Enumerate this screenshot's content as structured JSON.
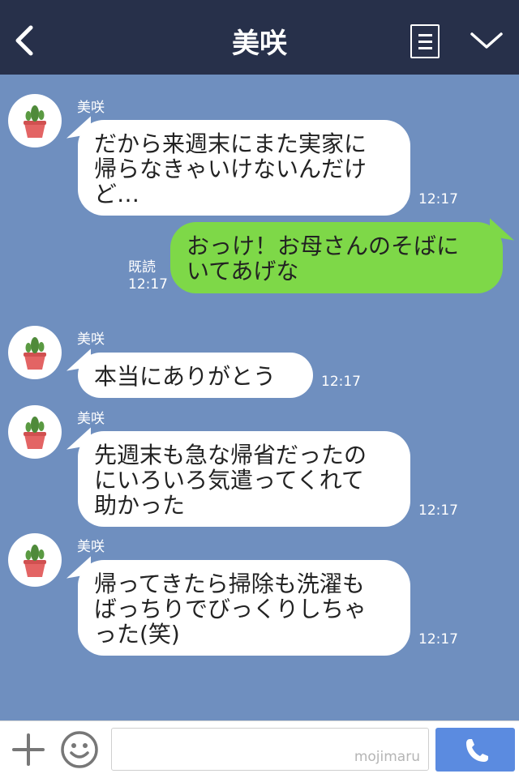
{
  "header": {
    "title": "美咲"
  },
  "messages": [
    {
      "type": "in",
      "sender": "美咲",
      "lines": [
        "だから来週末にまた実家に",
        "帰らなきゃいけないんだけ",
        "ど…"
      ],
      "time": "12:17"
    },
    {
      "type": "out",
      "lines": [
        "おっけ！お母さんのそばに",
        "いてあげな"
      ],
      "read": "既読",
      "time": "12:17"
    },
    {
      "type": "in",
      "sender": "美咲",
      "lines": [
        "本当にありがとう"
      ],
      "time": "12:17"
    },
    {
      "type": "in",
      "sender": "美咲",
      "lines": [
        "先週末も急な帰省だったの",
        "にいろいろ気遣ってくれて",
        "助かった"
      ],
      "time": "12:17"
    },
    {
      "type": "in",
      "sender": "美咲",
      "lines": [
        "帰ってきたら掃除も洗濯も",
        "ばっちりでびっくりしちゃ",
        "った(笑)"
      ],
      "time": "12:17"
    }
  ],
  "footer": {
    "watermark": "mojimaru"
  },
  "icons": {
    "back": "chevron-left-icon",
    "menu": "menu-list-icon",
    "more": "chevron-down-icon",
    "plus": "plus-icon",
    "emoji": "smiley-icon",
    "call": "phone-icon",
    "avatar": "cactus-icon"
  },
  "colors": {
    "header": "#27304a",
    "background": "#6f8fbf",
    "outgoing_bubble": "#7ed848",
    "incoming_bubble": "#ffffff",
    "call_button": "#5b8be0"
  }
}
